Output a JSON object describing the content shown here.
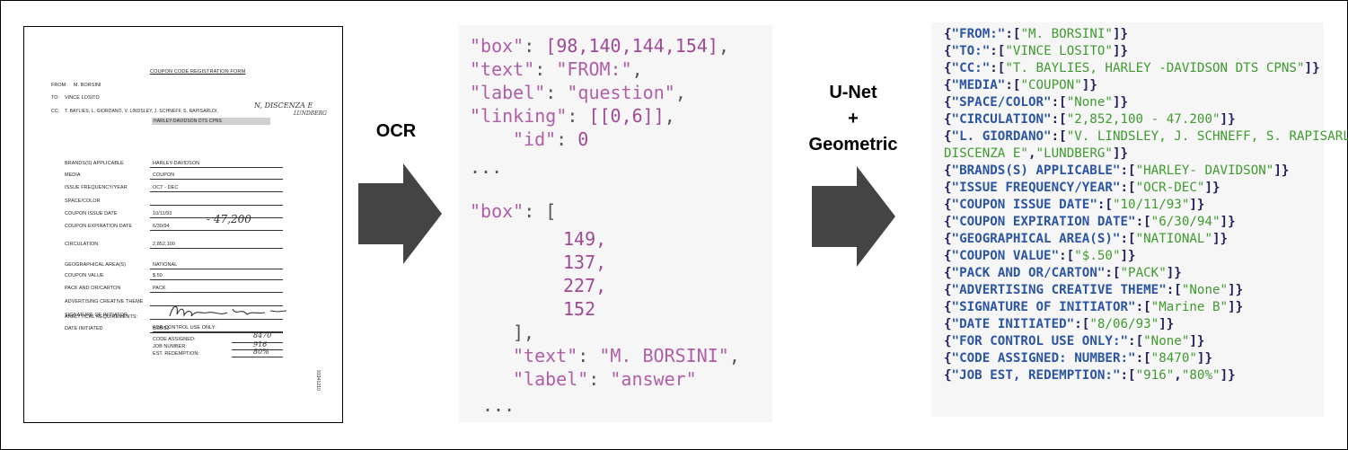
{
  "form": {
    "title": "COUPON CODE REGISTRATION FORM",
    "from_label": "FROM:",
    "from_value": "M. BORSINI",
    "to_label": "TO:",
    "to_value": "VINCE LOSITO",
    "cc_label": "CC:",
    "cc_value": "T. BAYLIES, L. GIORDANO, V. LINDSLEY, J. SCHNEFF, S. RAPISARLDI,",
    "cc_hand_1": "N, DISCENZA E",
    "cc_hand_2": "LUNDBERG",
    "cc_value_2": "HARLEY-DAVIDSON DTS CPNS",
    "rows": [
      {
        "label": "BRANDS(S) APPLICABLE",
        "value": "HARLEY-DAVIDSON"
      },
      {
        "label": "MEDIA",
        "value": "COUPON"
      },
      {
        "label": "ISSUE FREQUENCY/YEAR",
        "value": "OCT - DEC"
      },
      {
        "label": "SPACE/COLOR",
        "value": ""
      },
      {
        "label": "COUPON ISSUE DATE",
        "value": "10/11/93"
      },
      {
        "label": "COUPON EXPIRATION DATE",
        "value": "6/30/94"
      },
      {
        "label": "CIRCULATION",
        "value": "2,852,100"
      },
      {
        "label": "GEOGRAPHICAL AREA(S)",
        "value": "NATIONAL"
      },
      {
        "label": "COUPON VALUE",
        "value": "$.50"
      },
      {
        "label": "PACK AND OR/CARTON",
        "value": "PACK"
      },
      {
        "label": "ADVERTISING CREATIVE THEME",
        "value": ""
      },
      {
        "label": "SIGNATURE OF INITIATOR",
        "value": ""
      },
      {
        "label": "DATE INITIATED",
        "value": "8/06/93"
      }
    ],
    "circ_hand": "- 47,200",
    "analytical_label": "ANALYTICAL REQUIREMENTS:",
    "control_label": "FOR CONTROL USE ONLY:",
    "code_label": "CODE ASSIGNED:",
    "code_hand": "8470",
    "job_label": "JOB NUMBER:",
    "job_hand": "916",
    "est_label": "EST. REDEMPTION:",
    "est_hand": "80%",
    "doc_number": "91941210"
  },
  "labels": {
    "ocr": "OCR",
    "unet_1": "U-Net",
    "unet_2": "+",
    "unet_3": "Geometric"
  },
  "ocr_json": {
    "box1_key": "\"box\"",
    "box1_val": "[98,140,144,154]",
    "text1_key": "\"text\"",
    "text1_val": "\"FROM:\"",
    "label1_key": "\"label\"",
    "label1_val": "\"question\"",
    "linking_key": "\"linking\"",
    "linking_val": "[[0,6]]",
    "id_key": "\"id\"",
    "id_val": "0",
    "ellipsis1": "...",
    "box2_key": "\"box\"",
    "box2_vals": [
      "149,",
      "137,",
      "227,",
      "152"
    ],
    "text2_key": "\"text\"",
    "text2_val": "\"M. BORSINI\"",
    "label2_key": "\"label\"",
    "label2_val": "\"answer\"",
    "ellipsis2": "..."
  },
  "output": [
    {
      "key": "\"FROM:\"",
      "vals": [
        "\"M. BORSINI\""
      ]
    },
    {
      "key": "\"TO:\"",
      "vals": [
        "\"VINCE LOSITO\""
      ]
    },
    {
      "key": "\"CC:\"",
      "vals": [
        "\"T. BAYLIES, HARLEY -DAVIDSON DTS CPNS\""
      ]
    },
    {
      "key": "\"MEDIA\"",
      "vals": [
        "\"COUPON\""
      ]
    },
    {
      "key": "\"SPACE/COLOR\"",
      "vals": [
        "\"None\""
      ]
    },
    {
      "key": "\"CIRCULATION\"",
      "vals": [
        "\"2,852,100 - 47.200\""
      ]
    },
    {
      "key": "\"L. GIORDANO\"",
      "vals": [
        "\"V. LINDSLEY, J. SCHNEFF, S. RAPISARLDI, N, DISCENZA E\"",
        "\"LUNDBERG\""
      ]
    },
    {
      "key": "\"BRANDS(S) APPLICABLE\"",
      "vals": [
        "\"HARLEY- DAVIDSON\""
      ]
    },
    {
      "key": "\"ISSUE FREQUENCY/YEAR\"",
      "vals": [
        "\"OCR-DEC\""
      ]
    },
    {
      "key": "\"COUPON ISSUE DATE\"",
      "vals": [
        "\"10/11/93\""
      ]
    },
    {
      "key": "\"COUPON EXPIRATION DATE\"",
      "vals": [
        "\"6/30/94\""
      ]
    },
    {
      "key": "\"GEOGRAPHICAL AREA(S)\"",
      "vals": [
        "\"NATIONAL\""
      ]
    },
    {
      "key": "\"COUPON VALUE\"",
      "vals": [
        "\"$.50\""
      ]
    },
    {
      "key": "\"PACK AND OR/CARTON\"",
      "vals": [
        "\"PACK\""
      ]
    },
    {
      "key": "\"ADVERTISING CREATIVE THEME\"",
      "vals": [
        "\"None\""
      ]
    },
    {
      "key": "\"SIGNATURE OF INITIATOR\"",
      "vals": [
        "\"Marine B\""
      ]
    },
    {
      "key": "\"DATE INITIATED\"",
      "vals": [
        "\"8/06/93\""
      ]
    },
    {
      "key": "\"FOR CONTROL USE ONLY:\"",
      "vals": [
        "\"None\""
      ]
    },
    {
      "key": "\"CODE ASSIGNED: NUMBER:\"",
      "vals": [
        "\"8470\""
      ]
    },
    {
      "key": "\"JOB EST, REDEMPTION:\"",
      "vals": [
        "\"916\"",
        "\"80%\""
      ]
    }
  ]
}
